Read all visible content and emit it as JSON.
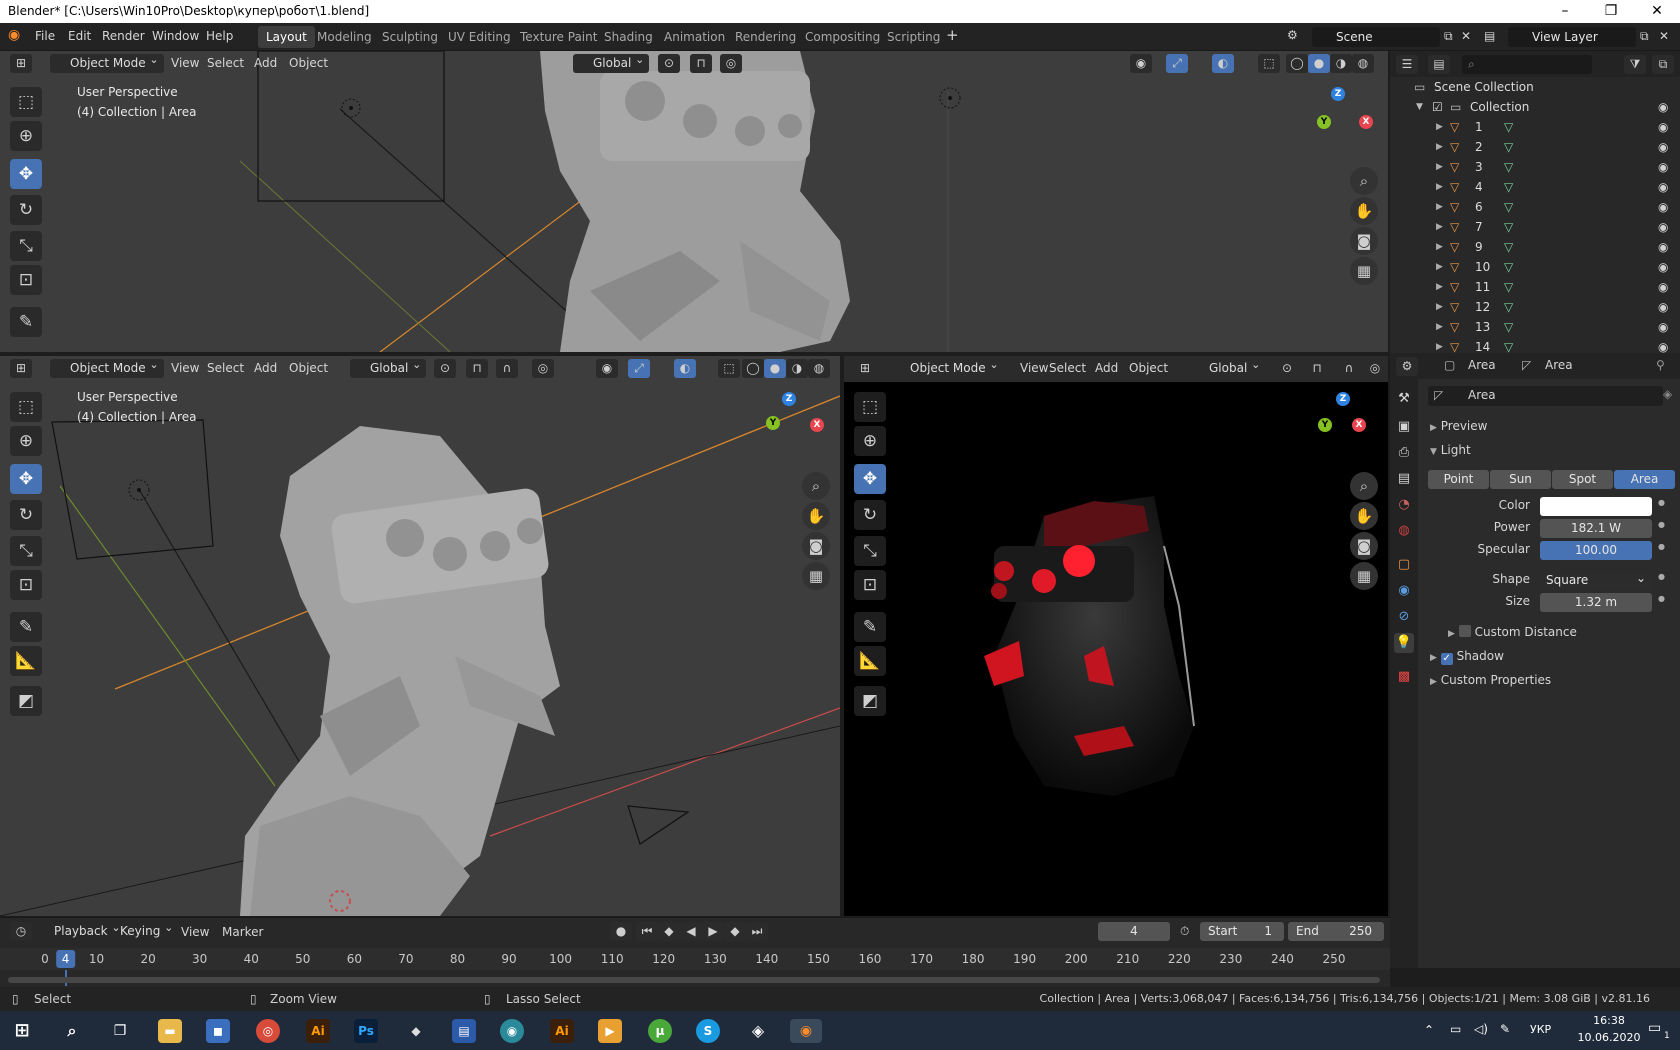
{
  "window": {
    "title": "Blender* [C:\\Users\\Win10Pro\\Desktop\\купер\\робот\\1.blend]"
  },
  "menu": [
    "File",
    "Edit",
    "Render",
    "Window",
    "Help"
  ],
  "workspaces": [
    "Layout",
    "Modeling",
    "Sculpting",
    "UV Editing",
    "Texture Paint",
    "Shading",
    "Animation",
    "Rendering",
    "Compositing",
    "Scripting"
  ],
  "active_workspace": "Layout",
  "scene": {
    "name": "Scene",
    "view_layer": "View Layer"
  },
  "viewport_header": {
    "mode": "Object Mode",
    "menus": [
      "View",
      "Select",
      "Add",
      "Object"
    ],
    "orientation": "Global"
  },
  "viewport_overlay": {
    "view": "User Perspective",
    "collection": "(4) Collection | Area"
  },
  "gizmo": {
    "z": "Z",
    "y": "Y",
    "x": "X"
  },
  "outliner": {
    "root": "Scene Collection",
    "collection": "Collection",
    "items": [
      "1",
      "2",
      "3",
      "4",
      "6",
      "7",
      "9",
      "10",
      "11",
      "12",
      "13",
      "14"
    ]
  },
  "properties": {
    "breadcrumb_object": "Area",
    "breadcrumb_data": "Area",
    "datablock": "Area",
    "panels": {
      "preview": "Preview",
      "light": "Light",
      "custom_distance": "Custom Distance",
      "shadow": "Shadow",
      "custom_properties": "Custom Properties"
    },
    "light_types": [
      "Point",
      "Sun",
      "Spot",
      "Area"
    ],
    "active_light_type": "Area",
    "labels": {
      "color": "Color",
      "power": "Power",
      "specular": "Specular",
      "shape": "Shape",
      "size": "Size"
    },
    "values": {
      "power": "182.1 W",
      "specular": "100.00",
      "shape": "Square",
      "size": "1.32 m"
    },
    "light_color": "#ffffff",
    "shadow_checked": true,
    "custom_distance_checked": false
  },
  "timeline": {
    "menus": [
      "Playback",
      "Keying",
      "View",
      "Marker"
    ],
    "current_frame": "4",
    "start_label": "Start",
    "start": "1",
    "end_label": "End",
    "end": "250",
    "ticks": [
      "0",
      "10",
      "20",
      "30",
      "40",
      "50",
      "60",
      "70",
      "80",
      "90",
      "100",
      "110",
      "120",
      "130",
      "140",
      "150",
      "160",
      "170",
      "180",
      "190",
      "200",
      "210",
      "220",
      "230",
      "240",
      "250"
    ]
  },
  "statusbar": {
    "select": "Select",
    "zoom": "Zoom View",
    "lasso": "Lasso Select",
    "stats": "Collection | Area | Verts:3,068,047 | Faces:6,134,756 | Tris:6,134,756 | Objects:1/21 | Mem: 3.08 GiB | v2.81.16"
  },
  "taskbar": {
    "lang": "УКР",
    "time": "16:38",
    "date": "10.06.2020",
    "notifications": "1"
  },
  "colors": {
    "accent": "#4772b3",
    "outliner_icon": "#e8954a",
    "mesh_icon": "#79d2a0",
    "axis_x": "#e8454f",
    "axis_y": "#86c224",
    "axis_z": "#2f83e0"
  }
}
